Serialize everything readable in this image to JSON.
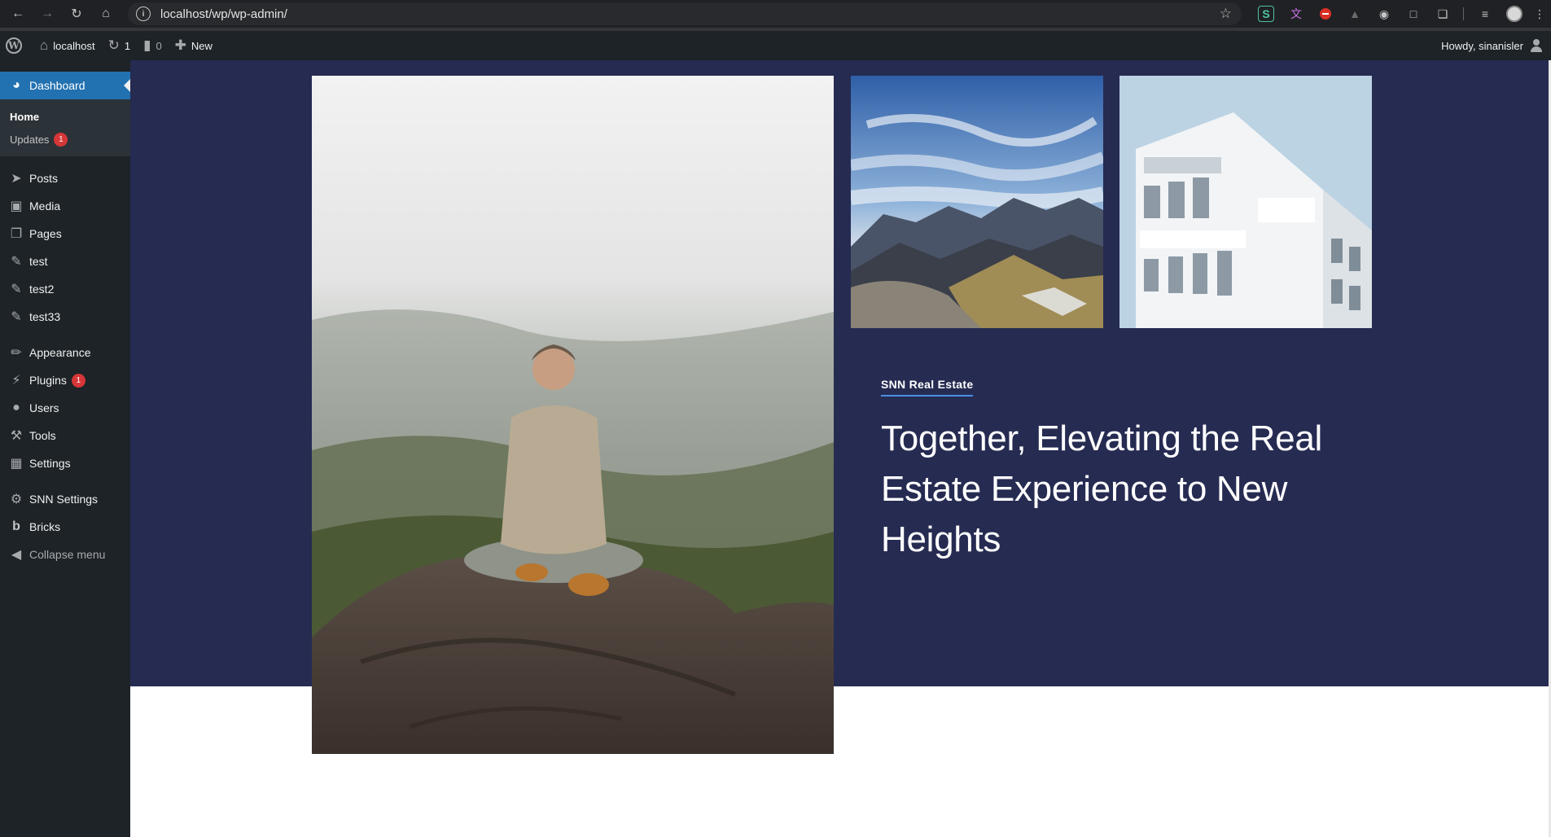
{
  "browser": {
    "url": "localhost/wp/wp-admin/",
    "nav_icons": [
      "back-arrow-icon",
      "forward-arrow-icon",
      "reload-icon",
      "home-icon"
    ],
    "extension_icons": [
      "grammar-extension-icon",
      "translate-extension-icon",
      "adblock-extension-icon",
      "screenshot-extension-icon",
      "crop-extension-icon",
      "puzzle-extensions-icon",
      "reading-list-icon",
      "profile-avatar-icon",
      "more-menu-icon"
    ],
    "extension_labels": {
      "grammar": "S",
      "translate": "文"
    }
  },
  "adminbar": {
    "site_name": "localhost",
    "updates_count": "1",
    "comments_count": "0",
    "new_label": "New",
    "greeting": "Howdy, sinanisler"
  },
  "sidebar": {
    "dashboard": "Dashboard",
    "submenu": [
      {
        "label": "Home",
        "current": true
      },
      {
        "label": "Updates",
        "badge": "1"
      }
    ],
    "items": [
      {
        "label": "Posts",
        "icon": "pin-icon"
      },
      {
        "label": "Media",
        "icon": "media-icon"
      },
      {
        "label": "Pages",
        "icon": "pages-icon"
      },
      {
        "label": "test",
        "icon": "edit-icon"
      },
      {
        "label": "test2",
        "icon": "edit-icon"
      },
      {
        "label": "test33",
        "icon": "edit-icon"
      }
    ],
    "items2": [
      {
        "label": "Appearance",
        "icon": "brush-icon"
      },
      {
        "label": "Plugins",
        "icon": "plugin-icon",
        "badge": "1"
      },
      {
        "label": "Users",
        "icon": "users-icon"
      },
      {
        "label": "Tools",
        "icon": "wrench-icon"
      },
      {
        "label": "Settings",
        "icon": "settings-icon"
      }
    ],
    "items3": [
      {
        "label": "SNN Settings",
        "icon": "gear-icon"
      },
      {
        "label": "Bricks",
        "icon": "bricks-icon"
      }
    ],
    "collapse": "Collapse menu"
  },
  "hero": {
    "eyebrow": "SNN Real Estate",
    "headline": "Together, Elevating the Real Estate Experience to New Heights",
    "images": [
      "meditating-woman-on-mountain-rock",
      "mountain-range-landscape",
      "white-modern-building"
    ]
  },
  "colors": {
    "hero_bg": "#262b52",
    "wp_admin_bg": "#1d2327",
    "wp_accent": "#2271b1",
    "badge": "#d63638",
    "eyebrow_underline": "#4a90e2"
  }
}
